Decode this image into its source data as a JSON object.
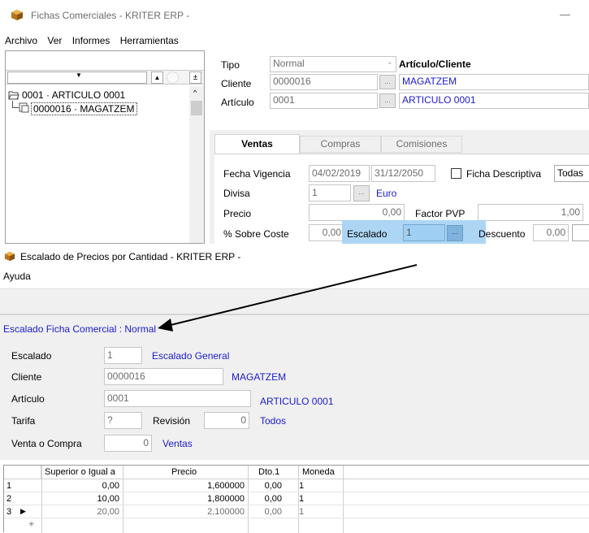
{
  "main_window": {
    "title": "Fichas Comerciales - KRITER ERP -",
    "minimize_glyph": "—",
    "menu": [
      "Archivo",
      "Ver",
      "Informes",
      "Herramientas"
    ],
    "tree": {
      "root": "0001 · ARTICULO 0001",
      "child": "0000016 · MAGATZEM"
    },
    "form": {
      "tipo_label": "Tipo",
      "tipo_value": "Normal",
      "header_right": "Artículo/Cliente",
      "cliente_label": "Cliente",
      "cliente_value": "0000016",
      "cliente_name": "MAGATZEM",
      "articulo_label": "Artículo",
      "articulo_value": "0001",
      "articulo_name": "ARTICULO 0001",
      "lookup_glyph": "...",
      "tabs": [
        "Ventas",
        "Compras",
        "Comisiones"
      ],
      "fecha_vigencia_label": "Fecha Vigencia",
      "fecha_desde": "04/02/2019",
      "fecha_hasta": "31/12/2050",
      "ficha_descriptiva_label": "Ficha Descriptiva",
      "todas_value": "Todas",
      "divisa_label": "Divisa",
      "divisa_value": "1",
      "divisa_name": "Euro",
      "precio_label": "Precio",
      "precio_value": "0,00",
      "factor_pvp_label": "Factor PVP",
      "factor_pvp_value": "1,00",
      "sobre_coste_label": "% Sobre Coste",
      "sobre_coste_value": "0,00",
      "escalado_label": "Escalado",
      "escalado_value": "1",
      "descuento_label": "Descuento",
      "descuento_value": "0,00"
    }
  },
  "escalado_window": {
    "title": "Escalado de Precios por Cantidad - KRITER ERP -",
    "menu": [
      "Ayuda"
    ],
    "subtitle": "Escalado Ficha Comercial : Normal",
    "escalado_label": "Escalado",
    "escalado_value": "1",
    "escalado_name": "Escalado General",
    "cliente_label": "Cliente",
    "cliente_value": "0000016",
    "cliente_name": "MAGATZEM",
    "articulo_label": "Artículo",
    "articulo_value": "0001",
    "articulo_name": "ARTICULO 0001",
    "tarifa_label": "Tarifa",
    "tarifa_value": "?",
    "revision_label": "Revisión",
    "revision_value": "0",
    "revision_name": "Todos",
    "venta_compra_label": "Venta o Compra",
    "venta_compra_value": "0",
    "venta_compra_name": "Ventas",
    "grid": {
      "columns": [
        "Superior o Igual a",
        "Precio",
        "Dto.1",
        "Moneda"
      ],
      "rows": [
        {
          "n": "1",
          "sup": "0,00",
          "precio": "1,600000",
          "dto": "0,00",
          "moneda": "1"
        },
        {
          "n": "2",
          "sup": "10,00",
          "precio": "1,800000",
          "dto": "0,00",
          "moneda": "1"
        },
        {
          "n": "3",
          "sup": "20,00",
          "precio": "2,100000",
          "dto": "0,00",
          "moneda": "1"
        }
      ],
      "new_row_glyph": "✳"
    }
  }
}
